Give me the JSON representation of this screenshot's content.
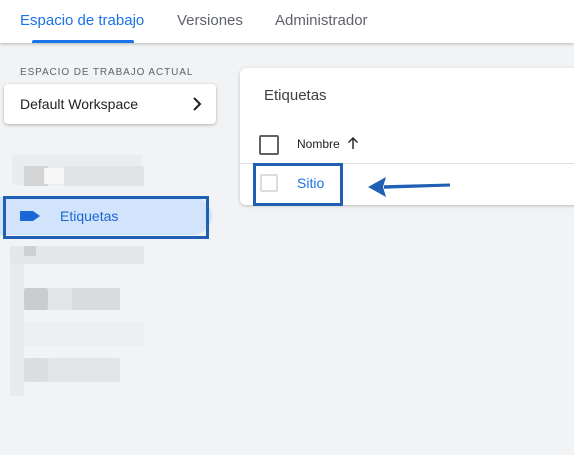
{
  "header": {
    "tabs": [
      {
        "label": "Espacio de trabajo",
        "active": true
      },
      {
        "label": "Versiones",
        "active": false
      },
      {
        "label": "Administrador",
        "active": false
      }
    ]
  },
  "sidebar": {
    "section_caption": "ESPACIO DE TRABAJO ACTUAL",
    "workspace_name": "Default Workspace",
    "selected_item": {
      "label": "Etiquetas",
      "icon": "tag-icon"
    }
  },
  "main": {
    "card_title": "Etiquetas",
    "table": {
      "columns": [
        {
          "label": "Nombre",
          "sort": "ascending"
        }
      ],
      "rows": [
        {
          "name": "Sitio"
        }
      ]
    }
  },
  "colors": {
    "accent": "#1a73e8",
    "selected_bg": "#d2e3fc",
    "annotation": "#1f5fb4"
  }
}
